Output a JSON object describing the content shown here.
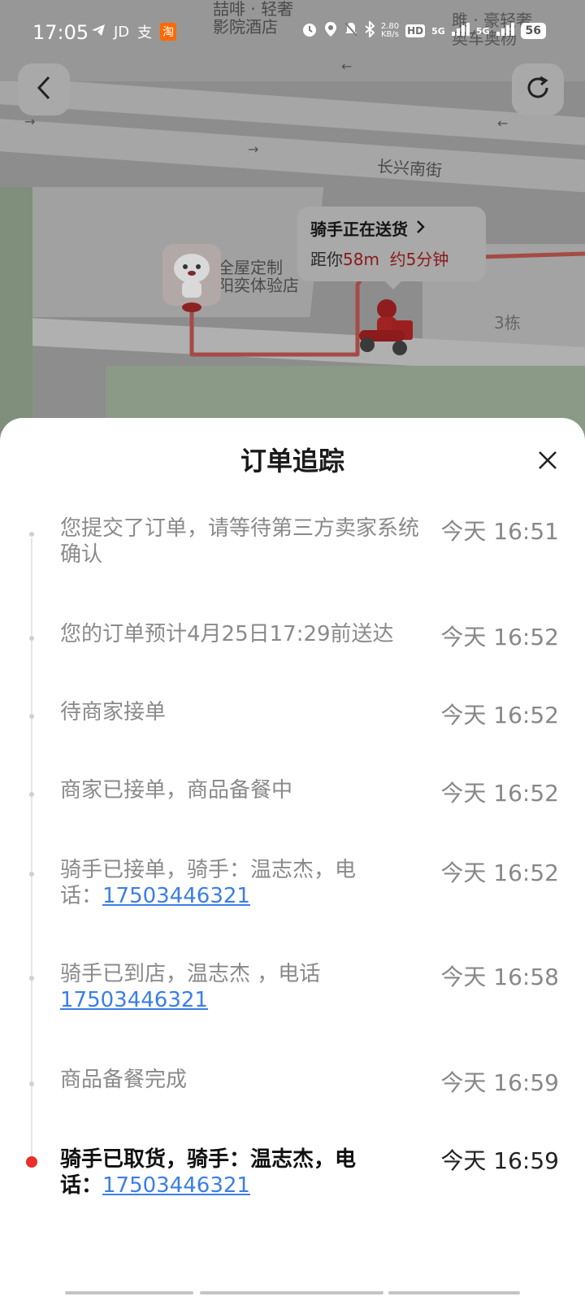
{
  "status_bar": {
    "time": "17:05",
    "app_icons": [
      "telegram-icon",
      "JD",
      "支",
      "淘"
    ],
    "speed": "2.80",
    "speed_unit": "KB/s",
    "hd": "HD",
    "net1": "5G",
    "net2": "5G",
    "battery": "56"
  },
  "map": {
    "labels": {
      "hotel": "喆啡 · 轻奢\n影院酒店",
      "top_right": "雎 · 豪轻奢\n奥车奥杨",
      "street": "长兴南街",
      "store": "全屋定制\n阳奕体验店",
      "building": "3栋"
    },
    "rider_bubble": {
      "title": "骑手正在送货",
      "prefix": "距你",
      "distance": "58m",
      "eta": "约5分钟"
    }
  },
  "sheet": {
    "title": "订单追踪",
    "timeline": [
      {
        "text": "您提交了订单，请等待第三方卖家系统确认",
        "time": "今天 16:51",
        "active": false
      },
      {
        "text": "您的订单预计4月25日17:29前送达",
        "time": "今天 16:52",
        "active": false
      },
      {
        "text": "待商家接单",
        "time": "今天 16:52",
        "active": false
      },
      {
        "text": "商家已接单，商品备餐中",
        "time": "今天 16:52",
        "active": false
      },
      {
        "text": "骑手已接单，骑手：温志杰，电话：",
        "phone": "17503446321",
        "time": "今天 16:52",
        "active": false
      },
      {
        "text": "骑手已到店，温志杰 ，电话",
        "phone": "17503446321",
        "time": "今天 16:58",
        "active": false
      },
      {
        "text": "商品备餐完成",
        "time": "今天 16:59",
        "active": false
      },
      {
        "text": "骑手已取货，骑手：温志杰，电话：",
        "phone": "17503446321",
        "time": "今天 16:59",
        "active": true
      }
    ]
  },
  "colors": {
    "accent_red": "#e8302a",
    "link_blue": "#3c7ee8",
    "route_red": "#c0392b"
  }
}
